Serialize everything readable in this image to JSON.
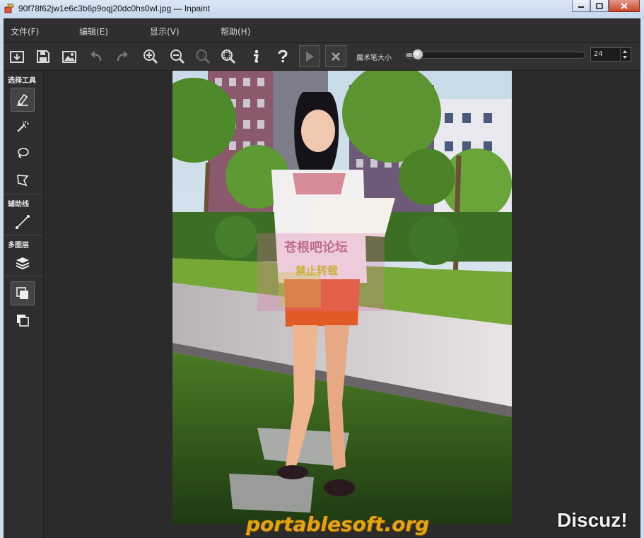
{
  "window": {
    "title": "90f78f62jw1e6c3b6p9oqj20dc0hs0wl.jpg — Inpaint"
  },
  "menu": {
    "items": [
      "文件(F)",
      "编辑(E)",
      "显示(V)",
      "帮助(H)"
    ]
  },
  "toolbar": {
    "buttons": [
      "open-icon",
      "save-icon",
      "image-icon",
      "undo-icon",
      "redo-icon",
      "zoom-in-icon",
      "zoom-out-icon",
      "zoom-actual-icon",
      "zoom-fit-icon",
      "info-icon",
      "help-icon",
      "play-icon",
      "cancel-icon"
    ],
    "brush_size_label": "魔术笔大小",
    "brush_size_value": "24",
    "brush_size_fraction": 0.04
  },
  "sidebar": {
    "sections": [
      {
        "label": "选择工具",
        "tools": [
          "marker-icon",
          "magic-wand-icon",
          "lasso-icon",
          "polygon-lasso-icon"
        ]
      },
      {
        "label": "辅助线",
        "tools": [
          "guide-line-icon"
        ]
      },
      {
        "label": "多图层",
        "tools": [
          "layers-icon",
          "layer-front-icon",
          "layer-back-icon"
        ]
      }
    ]
  },
  "watermarks": {
    "forum": "苍根吧论坛",
    "forbid": "禁止转载",
    "site": "portablesoft.org",
    "brand": "Discuz!"
  }
}
